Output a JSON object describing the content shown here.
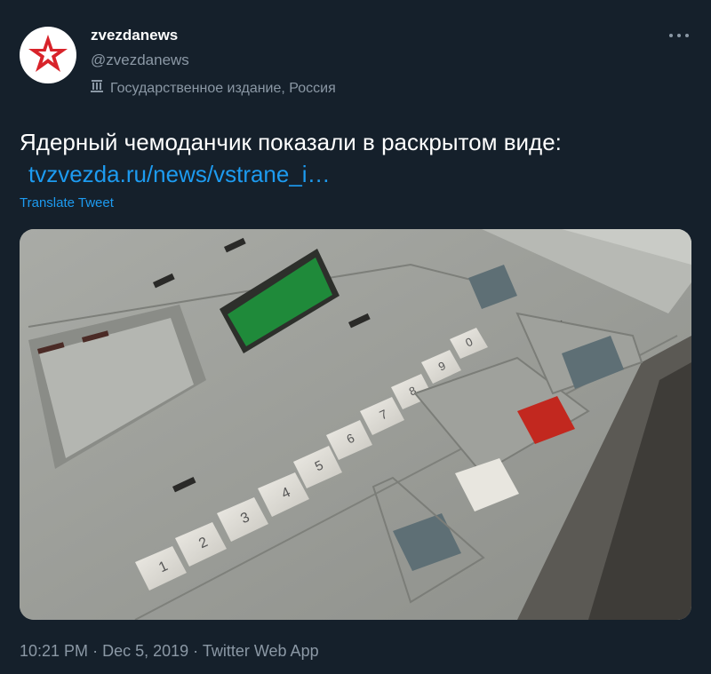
{
  "author": {
    "name": "zvezdanews",
    "handle": "@zvezdanews",
    "label": "Государственное издание, Россия"
  },
  "tweet": {
    "text": "Ядерный чемоданчик показали в раскрытом виде:",
    "link": "tvzvezda.ru/news/vstrane_i…",
    "translate": "Translate Tweet"
  },
  "media": {
    "keys": [
      "1",
      "2",
      "3",
      "4",
      "5",
      "6",
      "7",
      "8",
      "9",
      "0"
    ],
    "colors": {
      "red_button": "#c2281f",
      "white_button": "#e8e6df",
      "grey_button": "#5e6f75",
      "display": "#1f8a3a"
    }
  },
  "meta": {
    "time": "10:21 PM",
    "sep1": "·",
    "date": "Dec 5, 2019",
    "sep2": "·",
    "source": "Twitter Web App"
  },
  "theme": {
    "background": "#15202b",
    "accent": "#1d9bf0",
    "secondary_text": "#8b98a5"
  }
}
